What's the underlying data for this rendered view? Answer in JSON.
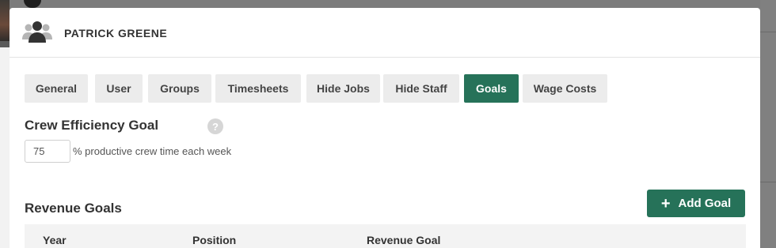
{
  "modal": {
    "title": "PATRICK GREENE",
    "header_icon": "users-group-icon"
  },
  "tabs": [
    {
      "label": "General",
      "active": false
    },
    {
      "label": "User",
      "active": false
    },
    {
      "label": "Groups",
      "active": false
    },
    {
      "label": "Timesheets",
      "active": false
    },
    {
      "label": "Hide Jobs",
      "active": false
    },
    {
      "label": "Hide Staff",
      "active": false
    },
    {
      "label": "Goals",
      "active": true
    },
    {
      "label": "Wage Costs",
      "active": false
    }
  ],
  "crew_efficiency": {
    "title": "Crew Efficiency Goal",
    "help": "?",
    "value": "75",
    "suffix": "% productive crew time each week"
  },
  "revenue_goals": {
    "title": "Revenue Goals",
    "add_button_label": "Add Goal",
    "add_button_icon": "plus-icon",
    "columns": [
      "Year",
      "Position",
      "Revenue Goal"
    ]
  },
  "colors": {
    "accent": "#267259",
    "tab_bg": "#ececec",
    "table_header_bg": "#f3f3f3"
  }
}
